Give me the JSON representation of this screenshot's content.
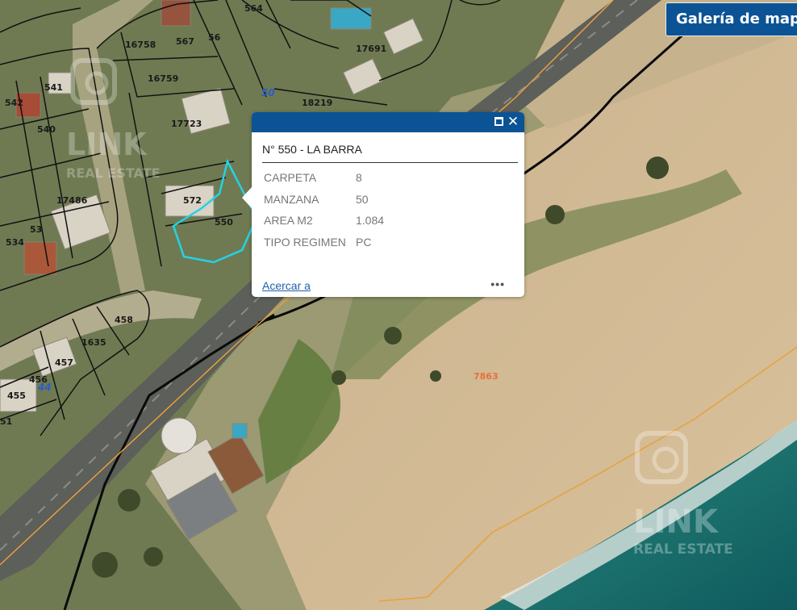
{
  "header": {
    "gallery_button": "Galería de mapa"
  },
  "popup": {
    "title": "N° 550 - LA BARRA",
    "maximize_icon": "maximize-icon",
    "close_icon": "close-icon",
    "attributes": [
      {
        "key": "CARPETA",
        "value": "8"
      },
      {
        "key": "MANZANA",
        "value": "50"
      },
      {
        "key": "AREA M2",
        "value": "1.084"
      },
      {
        "key": "TIPO REGIMEN",
        "value": "PC"
      }
    ],
    "zoom_link": "Acercar a",
    "more_icon": "ellipsis-icon"
  },
  "map": {
    "parcel_labels": [
      "564",
      "567",
      "56",
      "16758",
      "16759",
      "17723",
      "541",
      "542",
      "540",
      "17486",
      "572",
      "550",
      "534",
      "53",
      "17691",
      "18219",
      "458",
      "1635",
      "457",
      "456",
      "455",
      "51",
      "7863"
    ],
    "block_labels": [
      "50",
      "44"
    ],
    "watermark_line1": "LINK",
    "watermark_line2": "REAL ESTATE",
    "colors": {
      "selection": "#22d3e6",
      "parcel_line": "#111111",
      "boundary_line": "#e8a13a",
      "lot_7863": "#e8703a",
      "block_label": "#2b5cc9",
      "ui_blue": "#0b5394"
    }
  }
}
